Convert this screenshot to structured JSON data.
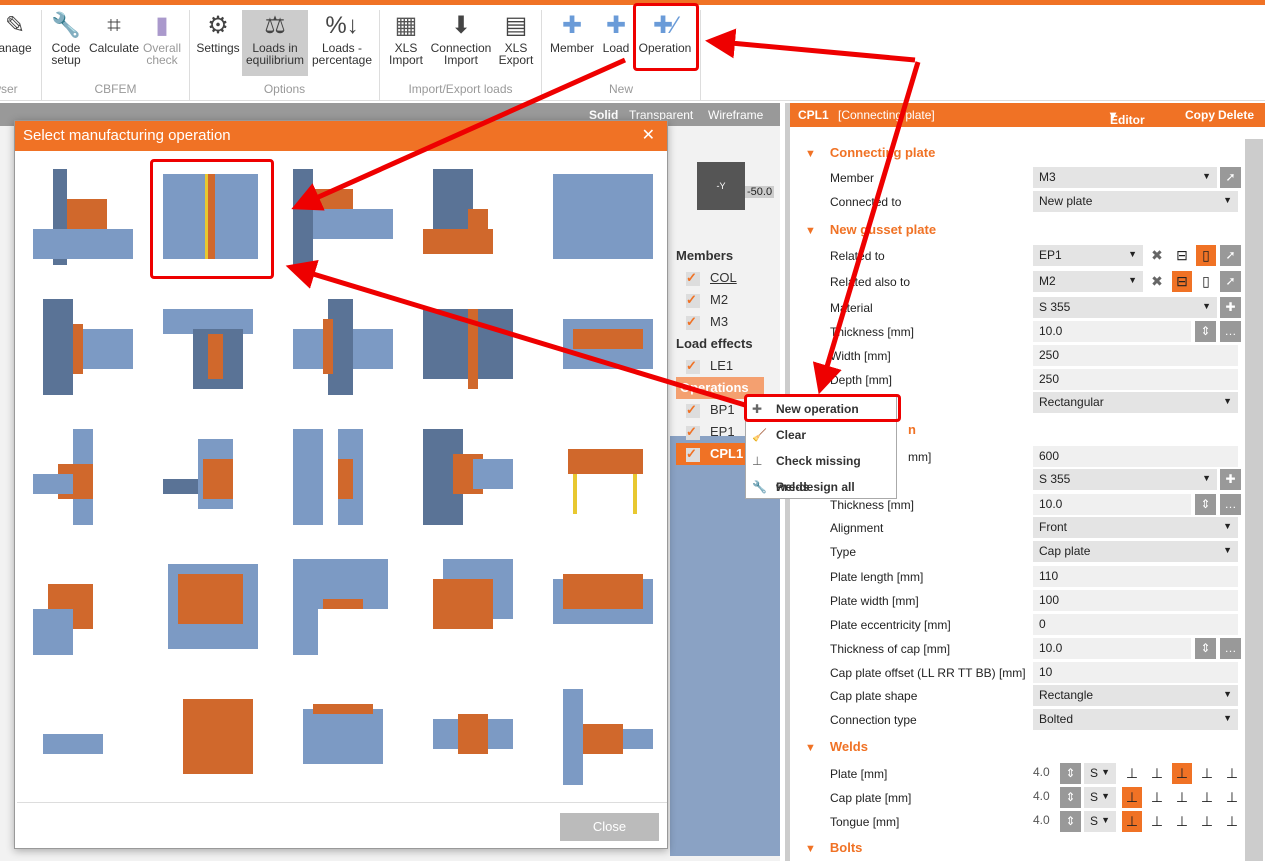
{
  "ribbon": {
    "buttons": [
      {
        "label": "anage",
        "icon": "manage-icon"
      },
      {
        "label": "Code\nsetup",
        "icon": "wrench-icon"
      },
      {
        "label": "Calculate",
        "icon": "abacus-icon"
      },
      {
        "label": "Overall\ncheck",
        "icon": "check-icon"
      },
      {
        "label": "Settings",
        "icon": "gear-icon"
      },
      {
        "label": "Loads in\nequilibrium",
        "icon": "scales-icon"
      },
      {
        "label": "Loads -\npercentage",
        "icon": "percent-icon"
      },
      {
        "label": "XLS\nImport",
        "icon": "excel-icon"
      },
      {
        "label": "Connection\nImport",
        "icon": "import-icon"
      },
      {
        "label": "XLS\nExport",
        "icon": "excel-export-icon"
      },
      {
        "label": "Member",
        "icon": "new-member-icon"
      },
      {
        "label": "Load",
        "icon": "new-load-icon"
      },
      {
        "label": "Operation",
        "icon": "new-operation-icon"
      }
    ],
    "groups": [
      "wser",
      "CBFEM",
      "Options",
      "Import/Export loads",
      "New"
    ]
  },
  "viewbar": {
    "solid": "Solid",
    "transparent": "Transparent",
    "wireframe": "Wireframe"
  },
  "view": {
    "cube_face": "-Y",
    "cube_value": "-50.0"
  },
  "tree": {
    "members_header": "Members",
    "members": [
      "COL",
      "M2",
      "M3"
    ],
    "loads_header": "Load effects",
    "loads": [
      "LE1"
    ],
    "operations_header": "Operations",
    "operations": [
      "BP1",
      "EP1",
      "CPL1"
    ]
  },
  "context_menu": {
    "items": [
      "New operation",
      "Clear",
      "Check missing welds",
      "Pre-design all"
    ]
  },
  "dialog": {
    "title": "Select manufacturing operation",
    "close_label": "Close",
    "tile_count": 25
  },
  "panel": {
    "header": {
      "name": "CPL1",
      "type": "[Connecting plate]",
      "editor": "Editor",
      "copy": "Copy",
      "delete": "Delete"
    },
    "sections": {
      "connecting": "Connecting plate",
      "gusset": "New gusset plate",
      "hidden": "n",
      "welds": "Welds",
      "bolts": "Bolts"
    },
    "rows": {
      "member": {
        "label": "Member",
        "value": "M3"
      },
      "connected": {
        "label": "Connected to",
        "value": "New plate"
      },
      "related": {
        "label": "Related to",
        "value": "EP1"
      },
      "related_also": {
        "label": "Related also to",
        "value": "M2"
      },
      "material": {
        "label": "Material",
        "value": "S 355"
      },
      "thickness": {
        "label": "Thickness [mm]",
        "value": "10.0"
      },
      "width": {
        "label": "Width [mm]",
        "value": "250"
      },
      "depth": {
        "label": "Depth [mm]",
        "value": "250"
      },
      "shape": {
        "value": "Rectangular"
      },
      "hidden_len": {
        "label": "mm]",
        "value": "600"
      },
      "material2": {
        "value": "S 355"
      },
      "thickness2": {
        "label": "Thickness [mm]",
        "value": "10.0"
      },
      "alignment": {
        "label": "Alignment",
        "value": "Front"
      },
      "type": {
        "label": "Type",
        "value": "Cap plate"
      },
      "plate_length": {
        "label": "Plate length [mm]",
        "value": "110"
      },
      "plate_width": {
        "label": "Plate width [mm]",
        "value": "100"
      },
      "plate_ecc": {
        "label": "Plate eccentricity [mm]",
        "value": "0"
      },
      "cap_thick": {
        "label": "Thickness of cap [mm]",
        "value": "10.0"
      },
      "cap_offset": {
        "label": "Cap plate offset (LL RR TT BB) [mm]",
        "value": "10"
      },
      "cap_shape": {
        "label": "Cap plate shape",
        "value": "Rectangle"
      },
      "conn_type": {
        "label": "Connection type",
        "value": "Bolted"
      }
    },
    "welds": [
      {
        "label": "Plate [mm]",
        "size": "4.0",
        "type": "S",
        "selected": 3
      },
      {
        "label": "Cap plate [mm]",
        "size": "4.0",
        "type": "S",
        "selected": 1
      },
      {
        "label": "Tongue [mm]",
        "size": "4.0",
        "type": "S",
        "selected": 1
      }
    ]
  },
  "colors": {
    "accent": "#f07225",
    "steel": "#7c9ac4",
    "annotation": "#e00000"
  }
}
